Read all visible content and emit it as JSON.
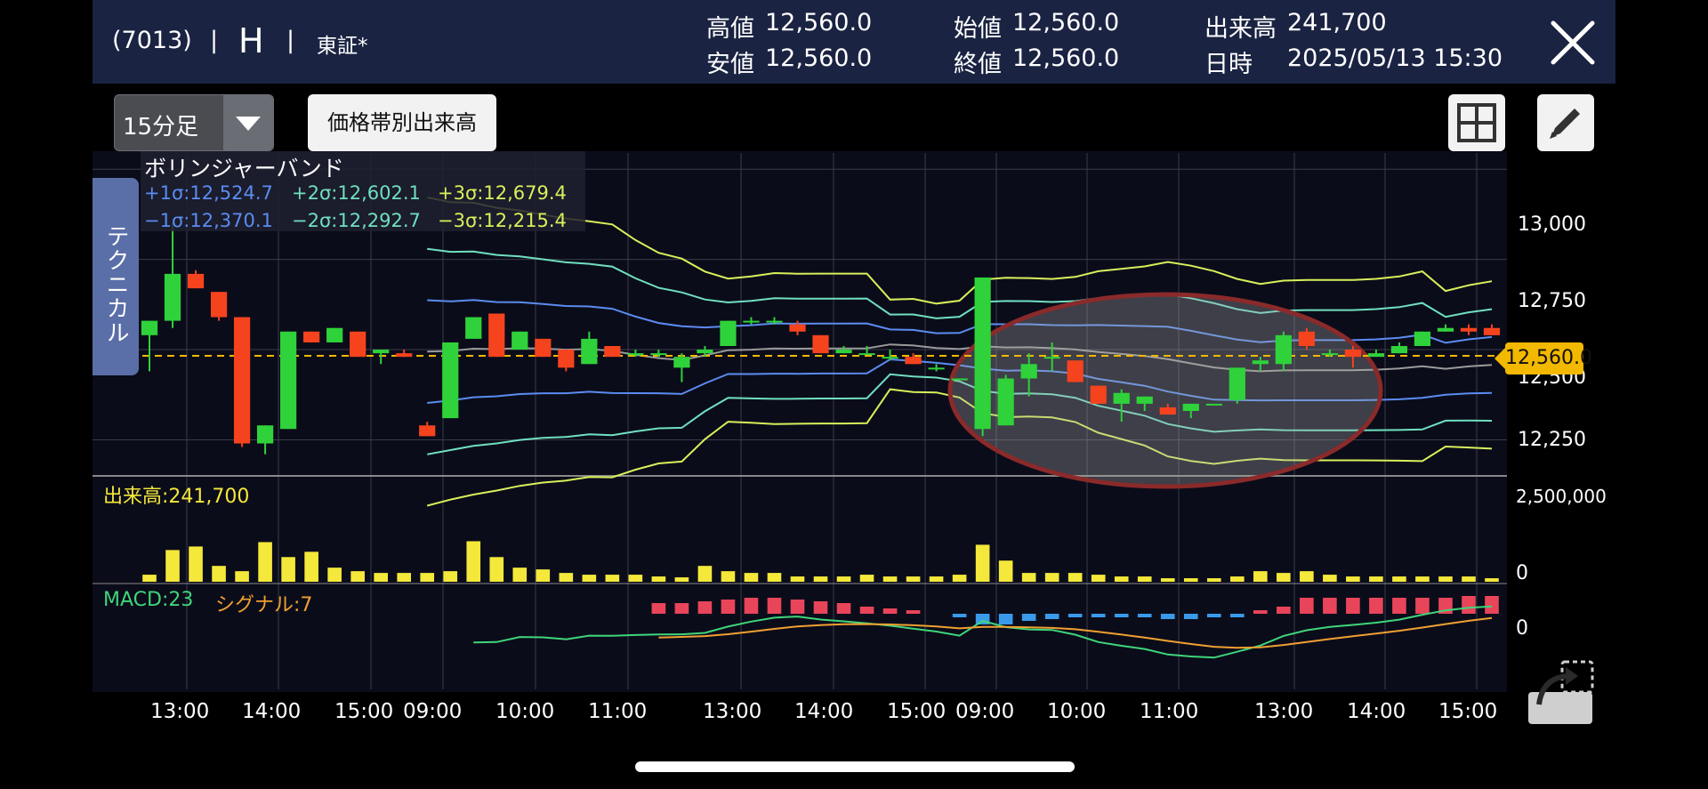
{
  "header": {
    "code": "(7013)",
    "separator": "|",
    "ticker": "H",
    "exchange": "東証*",
    "high_label": "高値",
    "high_value": "12,560.0",
    "low_label": "安値",
    "low_value": "12,560.0",
    "open_label": "始値",
    "open_value": "12,560.0",
    "close_label": "終値",
    "close_value": "12,560.0",
    "volume_label": "出来高",
    "volume_value": "241,700",
    "datetime_label": "日時",
    "datetime_value": "2025/05/13 15:30"
  },
  "toolbar": {
    "period_select": "15分足",
    "volume_profile_button": "価格帯別出来高",
    "grid_icon": "grid-icon",
    "draw_icon": "pencil-icon"
  },
  "side_tab": {
    "label": "テクニカル"
  },
  "bollinger": {
    "title": "ボリンジャーバンド",
    "p1": "+1σ:12,524.7",
    "p2": "+2σ:12,602.1",
    "p3": "+3σ:12,679.4",
    "m1": "−1σ:12,370.1",
    "m2": "−2σ:12,292.7",
    "m3": "−3σ:12,215.4",
    "colors": {
      "s1": "#5b8cf0",
      "s2": "#6fe0c0",
      "s3": "#d8f05a",
      "mid": "#9a9a9a"
    }
  },
  "price_axis": [
    "13,000",
    "12,750",
    "12,500",
    "12,250"
  ],
  "current_price": "12,560.0",
  "volume_pane": {
    "label": "出来高:241,700",
    "axis_top": "2,500,000",
    "axis_zero": "0"
  },
  "macd_pane": {
    "macd_label": "MACD:23",
    "signal_label": "シグナル:7",
    "axis_zero": "0"
  },
  "time_axis": [
    "13:00",
    "14:00",
    "15:00",
    "09:00",
    "10:00",
    "11:00",
    "13:00",
    "14:00",
    "15:00",
    "09:00",
    "10:00",
    "11:00",
    "13:00",
    "14:00",
    "15:00"
  ],
  "chart_data": {
    "type": "candlestick",
    "interval": "15分足",
    "price_range": [
      12150,
      13050
    ],
    "candles": [
      {
        "o": 12540,
        "h": 12580,
        "l": 12440,
        "c": 12580
      },
      {
        "o": 12580,
        "h": 12850,
        "l": 12560,
        "c": 12710
      },
      {
        "o": 12710,
        "h": 12720,
        "l": 12670,
        "c": 12670
      },
      {
        "o": 12660,
        "h": 12660,
        "l": 12580,
        "c": 12590
      },
      {
        "o": 12590,
        "h": 12590,
        "l": 12230,
        "c": 12240
      },
      {
        "o": 12240,
        "h": 12290,
        "l": 12210,
        "c": 12290
      },
      {
        "o": 12280,
        "h": 12550,
        "l": 12280,
        "c": 12550
      },
      {
        "o": 12550,
        "h": 12550,
        "l": 12520,
        "c": 12520
      },
      {
        "o": 12520,
        "h": 12560,
        "l": 12520,
        "c": 12560
      },
      {
        "o": 12550,
        "h": 12550,
        "l": 12480,
        "c": 12480
      },
      {
        "o": 12490,
        "h": 12500,
        "l": 12460,
        "c": 12500
      },
      {
        "o": 12490,
        "h": 12500,
        "l": 12480,
        "c": 12480
      },
      {
        "o": 12290,
        "h": 12300,
        "l": 12260,
        "c": 12260
      },
      {
        "o": 12310,
        "h": 12520,
        "l": 12310,
        "c": 12520
      },
      {
        "o": 12530,
        "h": 12590,
        "l": 12530,
        "c": 12590
      },
      {
        "o": 12600,
        "h": 12600,
        "l": 12480,
        "c": 12480
      },
      {
        "o": 12500,
        "h": 12550,
        "l": 12500,
        "c": 12550
      },
      {
        "o": 12530,
        "h": 12530,
        "l": 12480,
        "c": 12480
      },
      {
        "o": 12500,
        "h": 12500,
        "l": 12440,
        "c": 12450
      },
      {
        "o": 12460,
        "h": 12550,
        "l": 12460,
        "c": 12530
      },
      {
        "o": 12510,
        "h": 12510,
        "l": 12480,
        "c": 12480
      },
      {
        "o": 12490,
        "h": 12500,
        "l": 12480,
        "c": 12490
      },
      {
        "o": 12490,
        "h": 12500,
        "l": 12480,
        "c": 12490
      },
      {
        "o": 12450,
        "h": 12490,
        "l": 12410,
        "c": 12480
      },
      {
        "o": 12490,
        "h": 12510,
        "l": 12480,
        "c": 12500
      },
      {
        "o": 12510,
        "h": 12580,
        "l": 12510,
        "c": 12580
      },
      {
        "o": 12580,
        "h": 12590,
        "l": 12570,
        "c": 12580
      },
      {
        "o": 12580,
        "h": 12590,
        "l": 12570,
        "c": 12580
      },
      {
        "o": 12570,
        "h": 12580,
        "l": 12540,
        "c": 12550
      },
      {
        "o": 12540,
        "h": 12540,
        "l": 12490,
        "c": 12490
      },
      {
        "o": 12490,
        "h": 12510,
        "l": 12490,
        "c": 12500
      },
      {
        "o": 12490,
        "h": 12510,
        "l": 12490,
        "c": 12490
      },
      {
        "o": 12480,
        "h": 12500,
        "l": 12470,
        "c": 12480
      },
      {
        "o": 12480,
        "h": 12490,
        "l": 12460,
        "c": 12460
      },
      {
        "o": 12450,
        "h": 12460,
        "l": 12440,
        "c": 12450
      },
      {
        "o": 12420,
        "h": 12420,
        "l": 12420,
        "c": 12420
      },
      {
        "o": 12280,
        "h": 12700,
        "l": 12260,
        "c": 12700
      },
      {
        "o": 12290,
        "h": 12430,
        "l": 12290,
        "c": 12420
      },
      {
        "o": 12420,
        "h": 12490,
        "l": 12370,
        "c": 12460
      },
      {
        "o": 12480,
        "h": 12520,
        "l": 12440,
        "c": 12480
      },
      {
        "o": 12470,
        "h": 12470,
        "l": 12410,
        "c": 12410
      },
      {
        "o": 12400,
        "h": 12400,
        "l": 12350,
        "c": 12350
      },
      {
        "o": 12350,
        "h": 12390,
        "l": 12300,
        "c": 12380
      },
      {
        "o": 12350,
        "h": 12370,
        "l": 12330,
        "c": 12370
      },
      {
        "o": 12340,
        "h": 12350,
        "l": 12320,
        "c": 12320
      },
      {
        "o": 12330,
        "h": 12350,
        "l": 12310,
        "c": 12350
      },
      {
        "o": 12350,
        "h": 12350,
        "l": 12350,
        "c": 12350
      },
      {
        "o": 12360,
        "h": 12450,
        "l": 12350,
        "c": 12450
      },
      {
        "o": 12460,
        "h": 12480,
        "l": 12440,
        "c": 12470
      },
      {
        "o": 12460,
        "h": 12550,
        "l": 12440,
        "c": 12540
      },
      {
        "o": 12550,
        "h": 12560,
        "l": 12500,
        "c": 12510
      },
      {
        "o": 12490,
        "h": 12500,
        "l": 12480,
        "c": 12490
      },
      {
        "o": 12500,
        "h": 12510,
        "l": 12450,
        "c": 12480
      },
      {
        "o": 12480,
        "h": 12500,
        "l": 12480,
        "c": 12490
      },
      {
        "o": 12490,
        "h": 12520,
        "l": 12490,
        "c": 12510
      },
      {
        "o": 12510,
        "h": 12550,
        "l": 12510,
        "c": 12550
      },
      {
        "o": 12550,
        "h": 12570,
        "l": 12550,
        "c": 12560
      },
      {
        "o": 12560,
        "h": 12570,
        "l": 12540,
        "c": 12550
      },
      {
        "o": 12560,
        "h": 12570,
        "l": 12540,
        "c": 12540
      }
    ],
    "volume_max": 2500000,
    "volume": [
      0.08,
      0.36,
      0.4,
      0.18,
      0.12,
      0.45,
      0.28,
      0.34,
      0.16,
      0.12,
      0.1,
      0.1,
      0.1,
      0.12,
      0.46,
      0.28,
      0.16,
      0.14,
      0.1,
      0.08,
      0.08,
      0.08,
      0.06,
      0.05,
      0.18,
      0.12,
      0.1,
      0.1,
      0.06,
      0.06,
      0.06,
      0.08,
      0.06,
      0.06,
      0.06,
      0.08,
      0.42,
      0.24,
      0.1,
      0.1,
      0.1,
      0.08,
      0.06,
      0.06,
      0.04,
      0.04,
      0.04,
      0.06,
      0.12,
      0.1,
      0.12,
      0.08,
      0.06,
      0.06,
      0.06,
      0.06,
      0.06,
      0.06,
      0.04
    ],
    "macd_hist": [
      0,
      0,
      0,
      0,
      0,
      0,
      0,
      0,
      0,
      0,
      0,
      0,
      0,
      0,
      0,
      0,
      0,
      0,
      0,
      0,
      0,
      0,
      0.3,
      0.3,
      0.35,
      0.4,
      0.45,
      0.45,
      0.4,
      0.35,
      0.3,
      0.2,
      0.15,
      0.1,
      0,
      -0.1,
      -0.3,
      -0.3,
      -0.2,
      -0.15,
      -0.1,
      -0.1,
      -0.1,
      -0.1,
      -0.15,
      -0.15,
      -0.1,
      -0.1,
      0.1,
      0.2,
      0.45,
      0.45,
      0.45,
      0.45,
      0.45,
      0.45,
      0.45,
      0.5,
      0.5
    ],
    "bands_note": "Bollinger bands ±1σ, ±2σ, ±3σ with middle SMA"
  }
}
